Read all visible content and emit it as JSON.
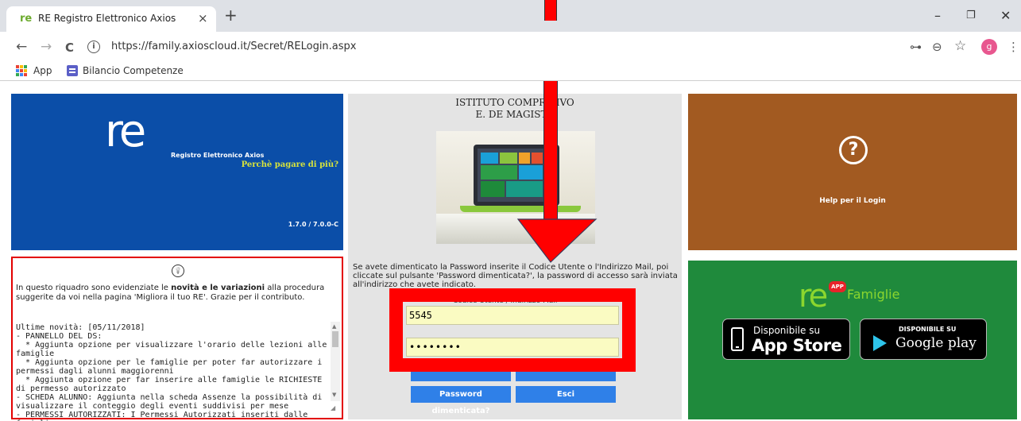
{
  "browser": {
    "tab_title": "RE Registro Elettronico Axios",
    "tab_favicon": "re",
    "tab_close": "×",
    "new_tab": "+",
    "minimize": "–",
    "maximize": "❐",
    "close": "✕",
    "back": "←",
    "forward": "→",
    "reload": "C",
    "url_info": "i",
    "url": "https://family.axioscloud.it/Secret/RELogin.aspx",
    "key_icon": "⊶",
    "zoom_icon": "⊖",
    "star_icon": "☆",
    "profile_initial": "g",
    "menu_icon": "⋮",
    "bookmarks": {
      "apps_label": "App",
      "item_1": "Bilancio Competenze"
    }
  },
  "re_panel": {
    "logo": "re",
    "subtitle": "Registro Elettronico Axios",
    "slogan": "Perchè pagare di più?",
    "version": "1.7.0 / 7.0.0-C"
  },
  "center_panel": {
    "school_line_1": "ISTITUTO COMPRE        IVO",
    "school_line_2": "E. DE MAGISTR",
    "forgot_text": "Se avete dimenticato la Password inserite il Codice Utente o l'Indirizzo Mail, poi cliccate sul pulsante 'Password dimenticata?', la password di accesso sarà inviata all'indirizzo che avete indicato.",
    "login_legend": "Codice Utente / Indirizzo Mail",
    "user_value": "5545",
    "password_value": "••••••••",
    "forgot_button": "Password dimenticata?",
    "exit_button": "Esci"
  },
  "help_panel": {
    "icon": "?",
    "label": "Help per il Login"
  },
  "news_panel": {
    "icon": "💡",
    "intro_before": "In questo riquadro sono evidenziate le ",
    "intro_bold": "novità e le variazioni",
    "intro_after": " alla procedura suggerite da voi nella pagina 'Migliora il tuo RE'. Grazie per il contributo.",
    "body": "Ultime novità: [05/11/2018]\n- PANNELLO DEL DS:\n  * Aggiunta opzione per visualizzare l'orario delle lezioni alle famiglie\n  * Aggiunta opzione per le famiglie per poter far autorizzare i permessi dagli alunni maggiorenni\n  * Aggiunta opzione per far inserire alle famiglie le RICHIESTE di permesso autorizzato\n- SCHEDA ALUNNO: Aggiunta nella scheda Assenze la possibilità di visualizzare il conteggio degli eventi suddivisi per mese\n- PERMESSI AUTORIZZATI: I Permessi Autorizzati inseriti dalle famiglie",
    "scroll_up": "▲",
    "scroll_down": "▼",
    "grip": "◢"
  },
  "app_panel": {
    "logo": "re",
    "badge": "APP",
    "name": "Famiglie",
    "appstore_small": "Disponibile su",
    "appstore_big": "App Store",
    "play_small": "DISPONIBILE SU",
    "play_big": "Google play"
  },
  "colors": {
    "re_blue": "#0b4ea8",
    "help_brown": "#a25a21",
    "app_green": "#1f8a3c",
    "button_blue": "#2f80e8",
    "highlight_red": "#ff0000"
  }
}
